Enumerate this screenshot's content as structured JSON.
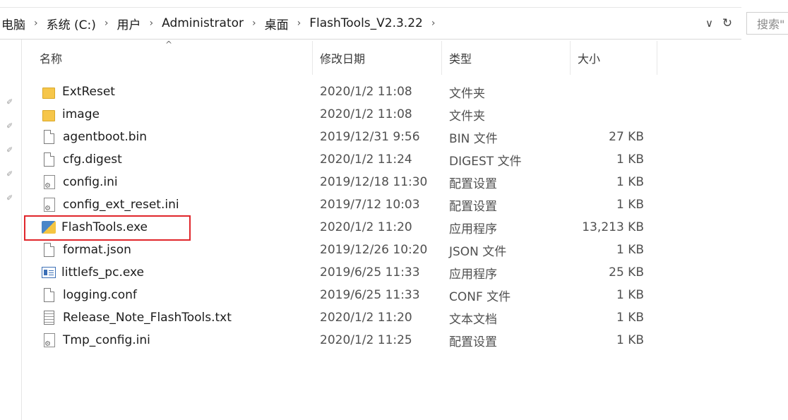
{
  "address_bar": {
    "crumbs": [
      "电脑",
      "系统 (C:)",
      "用户",
      "Administrator",
      "桌面",
      "FlashTools_V2.3.22"
    ],
    "search_placeholder": "搜索\""
  },
  "columns": {
    "name": "名称",
    "date": "修改日期",
    "type": "类型",
    "size": "大小"
  },
  "files": [
    {
      "name": "ExtReset",
      "date": "2020/1/2 11:08",
      "type": "文件夹",
      "size": "",
      "icon": "folder-icon"
    },
    {
      "name": "image",
      "date": "2020/1/2 11:08",
      "type": "文件夹",
      "size": "",
      "icon": "folder-icon"
    },
    {
      "name": "agentboot.bin",
      "date": "2019/12/31 9:56",
      "type": "BIN 文件",
      "size": "27 KB",
      "icon": "file-icon"
    },
    {
      "name": "cfg.digest",
      "date": "2020/1/2 11:24",
      "type": "DIGEST 文件",
      "size": "1 KB",
      "icon": "file-icon"
    },
    {
      "name": "config.ini",
      "date": "2019/12/18 11:30",
      "type": "配置设置",
      "size": "1 KB",
      "icon": "settings-file-icon"
    },
    {
      "name": "config_ext_reset.ini",
      "date": "2019/7/12 10:03",
      "type": "配置设置",
      "size": "1 KB",
      "icon": "settings-file-icon"
    },
    {
      "name": "FlashTools.exe",
      "date": "2020/1/2 11:20",
      "type": "应用程序",
      "size": "13,213 KB",
      "icon": "app-icon"
    },
    {
      "name": "format.json",
      "date": "2019/12/26 10:20",
      "type": "JSON 文件",
      "size": "1 KB",
      "icon": "file-icon"
    },
    {
      "name": "littlefs_pc.exe",
      "date": "2019/6/25 11:33",
      "type": "应用程序",
      "size": "25 KB",
      "icon": "window-app-icon"
    },
    {
      "name": "logging.conf",
      "date": "2019/6/25 11:33",
      "type": "CONF 文件",
      "size": "1 KB",
      "icon": "file-icon"
    },
    {
      "name": "Release_Note_FlashTools.txt",
      "date": "2020/1/2 11:20",
      "type": "文本文档",
      "size": "1 KB",
      "icon": "text-file-icon"
    },
    {
      "name": "Tmp_config.ini",
      "date": "2020/1/2 11:25",
      "type": "配置设置",
      "size": "1 KB",
      "icon": "settings-file-icon"
    }
  ],
  "highlight_color": "#e0262b"
}
